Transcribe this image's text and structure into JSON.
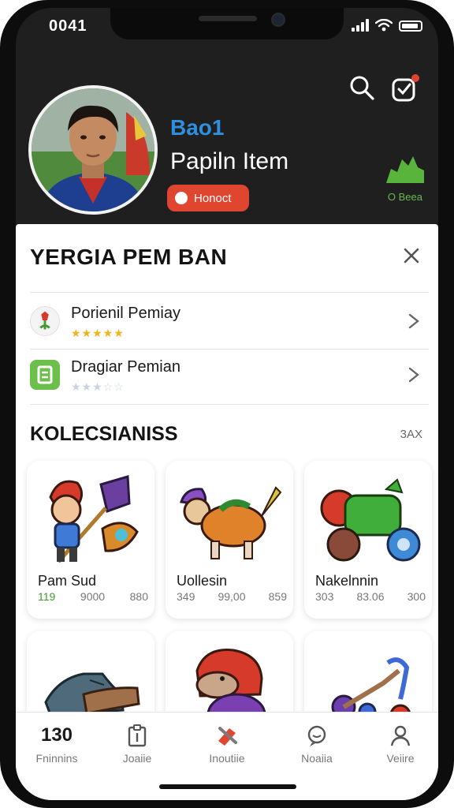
{
  "status_bar": {
    "time": "0041"
  },
  "header": {
    "profile_subtitle": "Bao1",
    "profile_name": "Papiln Item",
    "connect_label": "Honoct",
    "tree_label": "O Beea",
    "accent": "#e0452f",
    "subtitle_color": "#2e8fe0"
  },
  "sheet": {
    "title": "YERGIA PEM BAN",
    "items": [
      {
        "label": "Porienil Pemiay",
        "stars": "★★★★★",
        "rating": 5,
        "star_color": "#f1b318"
      },
      {
        "label": "Dragiar Pemian",
        "stars": "★★★☆☆",
        "rating": 3,
        "star_color": "#c9d3e3"
      }
    ]
  },
  "collection": {
    "title": "KOLECSIANISS",
    "count": "3AX",
    "cards": [
      {
        "title": "Pam Sud",
        "stats": [
          "119",
          "9000",
          "880"
        ]
      },
      {
        "title": "Uollesin",
        "stats": [
          "349",
          "99,00",
          "859"
        ]
      },
      {
        "title": "Nakelnnin",
        "stats": [
          "303",
          "83.06",
          "300"
        ]
      },
      {
        "title": "",
        "stats": []
      },
      {
        "title": "",
        "stats": []
      },
      {
        "title": "",
        "stats": []
      }
    ]
  },
  "tab_bar": {
    "tabs": [
      {
        "top": "130",
        "label": "Fninnins",
        "icon": "none"
      },
      {
        "label": "Joaiie",
        "icon": "clipboard-icon"
      },
      {
        "label": "Inoutiie",
        "icon": "tools-icon"
      },
      {
        "label": "Noaiia",
        "icon": "chat-icon"
      },
      {
        "label": "Veiire",
        "icon": "user-icon"
      }
    ]
  }
}
